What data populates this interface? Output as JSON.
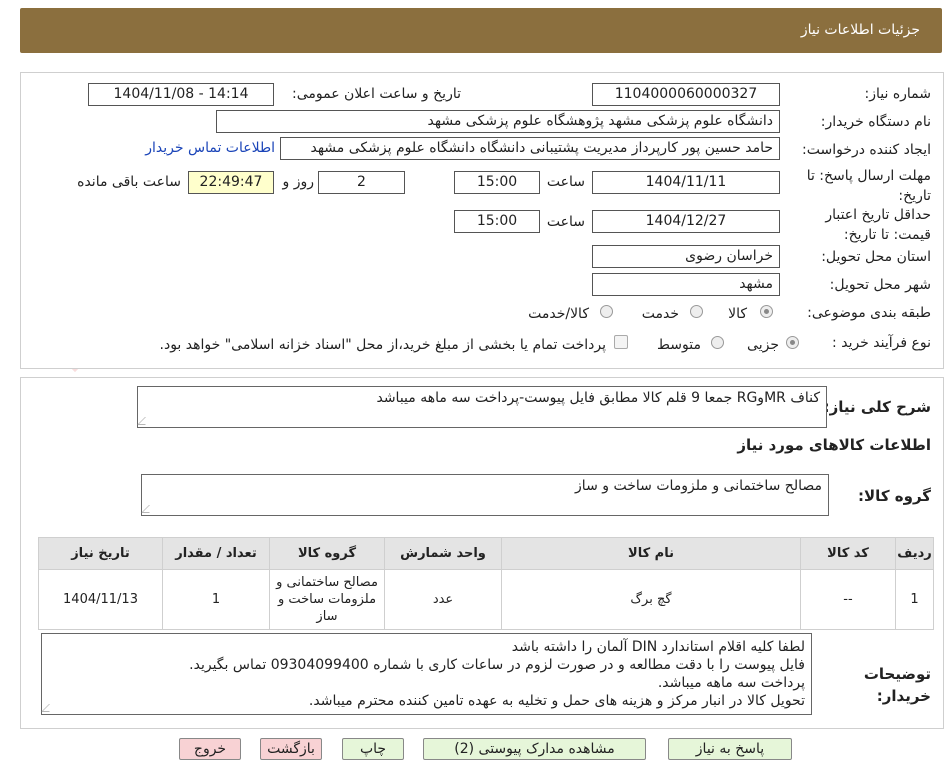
{
  "header": {
    "title": "جزئیات اطلاعات نیاز"
  },
  "watermark": {
    "text": "AriaTender.neT"
  },
  "form": {
    "need_number_label": "شماره نیاز:",
    "need_number": "1104000060000327",
    "announce_label": "تاریخ و ساعت اعلان عمومی:",
    "announce_value": "1404/11/08 - 14:14",
    "buyer_org_label": "نام دستگاه خریدار:",
    "buyer_org": "دانشگاه علوم پزشکی مشهد   پژوهشگاه علوم پزشکی مشهد",
    "creator_label": "ایجاد کننده درخواست:",
    "creator": "حامد حسین پور کارپرداز مدیریت پشتیبانی دانشگاه دانشگاه علوم پزشکی مشهد",
    "contact_link": "اطلاعات تماس خریدار",
    "deadline_label": "مهلت ارسال پاسخ: تا تاریخ:",
    "deadline_date": "1404/11/11",
    "time_label": "ساعت",
    "deadline_time": "15:00",
    "days_value": "2",
    "days_label": "روز و",
    "remaining_time": "22:49:47",
    "remaining_label": "ساعت باقی مانده",
    "validity_label": "حداقل تاریخ اعتبار قیمت: تا تاریخ:",
    "validity_date": "1404/12/27",
    "validity_time": "15:00",
    "province_label": "استان محل تحویل:",
    "province": "خراسان رضوی",
    "city_label": "شهر محل تحویل:",
    "city": "مشهد",
    "category_label": "طبقه بندی موضوعی:",
    "category_options": [
      "کالا",
      "خدمت",
      "کالا/خدمت"
    ],
    "process_label": "نوع فرآیند خرید :",
    "process_options": [
      "جزیی",
      "متوسط"
    ],
    "payment_note": "پرداخت تمام یا بخشی از مبلغ خرید،از محل \"اسناد خزانه اسلامی\" خواهد بود."
  },
  "summary": {
    "label": "شرح کلی نیاز:",
    "text": "کناف MRوRG جمعا 9 قلم کالا مطابق فایل پیوست-پرداخت سه ماهه میباشد",
    "goods_info_title": "اطلاعات کالاهای مورد نیاز",
    "group_label": "گروه کالا:",
    "group_value": "مصالح ساختمانی و ملزومات ساخت و ساز"
  },
  "table": {
    "headers": [
      "ردیف",
      "کد کالا",
      "نام کالا",
      "واحد شمارش",
      "گروه کالا",
      "تعداد / مقدار",
      "تاریخ نیاز"
    ],
    "rows": [
      {
        "row": "1",
        "code": "--",
        "name": "گچ برگ",
        "unit": "عدد",
        "group": "مصالح ساختمانی و ملزومات ساخت و ساز",
        "qty": "1",
        "date": "1404/11/13"
      }
    ]
  },
  "notes": {
    "label": "توضیحات خریدار:",
    "lines": [
      "لطفا کلیه اقلام استاندارد DIN آلمان را داشته باشد",
      "فایل پیوست را با دقت مطالعه و در صورت لزوم در ساعات کاری با شماره 09304099400 تماس بگیرید.",
      "پرداخت سه ماهه میباشد.",
      "تحویل کالا در انبار مرکز و هزینه های حمل و تخلیه به عهده تامین کننده محترم میباشد."
    ]
  },
  "buttons": {
    "reply": "پاسخ به نیاز",
    "attachments": "مشاهده مدارک پیوستی (2)",
    "print": "چاپ",
    "back": "بازگشت",
    "exit": "خروج"
  }
}
